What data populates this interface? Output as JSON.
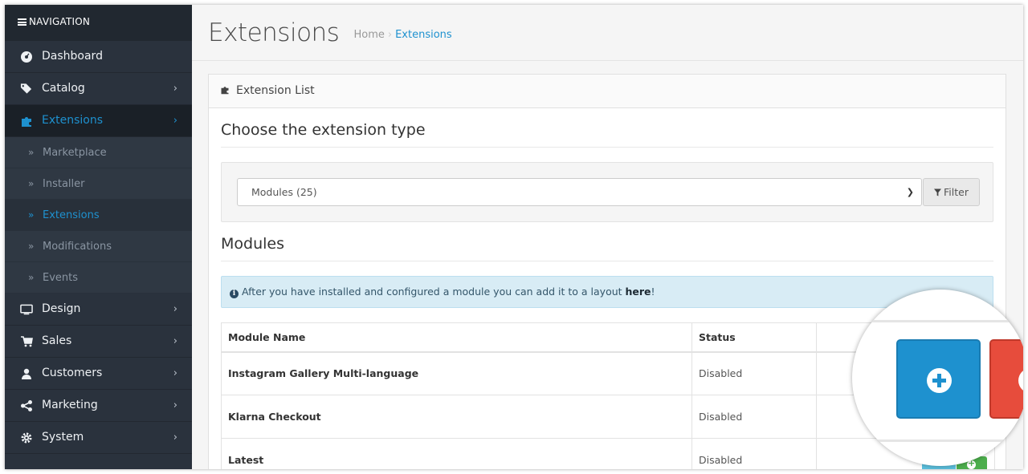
{
  "sidebar": {
    "header": "NAVIGATION",
    "items": [
      {
        "label": "Dashboard",
        "icon": "dashboard-icon"
      },
      {
        "label": "Catalog",
        "icon": "tags-icon"
      },
      {
        "label": "Extensions",
        "icon": "puzzle-icon",
        "active": true
      },
      {
        "label": "Design",
        "icon": "monitor-icon"
      },
      {
        "label": "Sales",
        "icon": "cart-icon"
      },
      {
        "label": "Customers",
        "icon": "user-icon"
      },
      {
        "label": "Marketing",
        "icon": "share-icon"
      },
      {
        "label": "System",
        "icon": "cog-icon"
      }
    ],
    "subitems": [
      {
        "label": "Marketplace"
      },
      {
        "label": "Installer"
      },
      {
        "label": "Extensions",
        "active": true
      },
      {
        "label": "Modifications"
      },
      {
        "label": "Events"
      }
    ]
  },
  "header": {
    "title": "Extensions",
    "breadcrumb": [
      "Home",
      "Extensions"
    ]
  },
  "panel": {
    "title": "Extension List",
    "choose_heading": "Choose the extension type",
    "select_value": "Modules (25)",
    "filter_label": "Filter",
    "modules_heading": "Modules",
    "alert_text": "After you have installed and configured a module you can add it to a layout ",
    "alert_link": "here",
    "alert_end": "!"
  },
  "table": {
    "columns": [
      "Module Name",
      "Status",
      ""
    ],
    "rows": [
      {
        "name": "Instagram Gallery Multi-language",
        "status": "Disabled"
      },
      {
        "name": "Klarna Checkout",
        "status": "Disabled"
      },
      {
        "name": "Latest",
        "status": "Disabled"
      }
    ]
  },
  "colors": {
    "accent": "#1e91cf",
    "sidebar_bg": "#2a323d",
    "install_button": "#1e91cf",
    "uninstall_button": "#e74c3c",
    "edit_button": "#5bc0de",
    "add_button": "#4cae4c"
  }
}
